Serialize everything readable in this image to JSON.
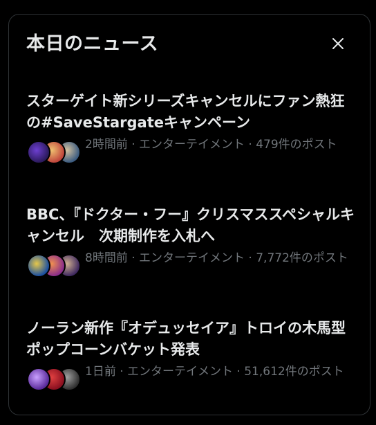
{
  "panel": {
    "title": "本日のニュース",
    "close_icon": "close-icon"
  },
  "news": [
    {
      "title": "スターゲイト新シリーズキャンセルにファン熱狂の#SaveStargateキャンペーン",
      "meta": "2時間前 · エンターテイメント · 479件のポスト",
      "avatar_icons": [
        "stargate-avatar",
        "fan-avatar",
        "user-avatar"
      ],
      "avatar_colors": [
        [
          "#2b1a5c",
          "#6d3fd1"
        ],
        [
          "#c0463c",
          "#f0c070"
        ],
        [
          "#3c5c80",
          "#d4c2a0"
        ]
      ]
    },
    {
      "title": "BBC、『ドクター・フー』クリスマススペシャルキャンセル　次期制作を入札へ",
      "meta": "8時間前 · エンターテイメント · 7,772件のポスト",
      "avatar_icons": [
        "tardis-avatar",
        "doctor-who-avatar",
        "user-avatar"
      ],
      "avatar_colors": [
        [
          "#1a4fa0",
          "#e7c84a"
        ],
        [
          "#8a2d8a",
          "#f09050"
        ],
        [
          "#402a60",
          "#d0b090"
        ]
      ]
    },
    {
      "title": "ノーラン新作『オデュッセイア』トロイの木馬型ポップコーンバケット発表",
      "meta": "1日前 · エンターテイメント · 51,612件のポスト",
      "avatar_icons": [
        "channel-avatar",
        "brand-avatar",
        "user-avatar"
      ],
      "avatar_colors": [
        [
          "#5a2a9a",
          "#c9a0ff"
        ],
        [
          "#8a1020",
          "#e04040"
        ],
        [
          "#303030",
          "#a0a0a0"
        ]
      ]
    }
  ]
}
